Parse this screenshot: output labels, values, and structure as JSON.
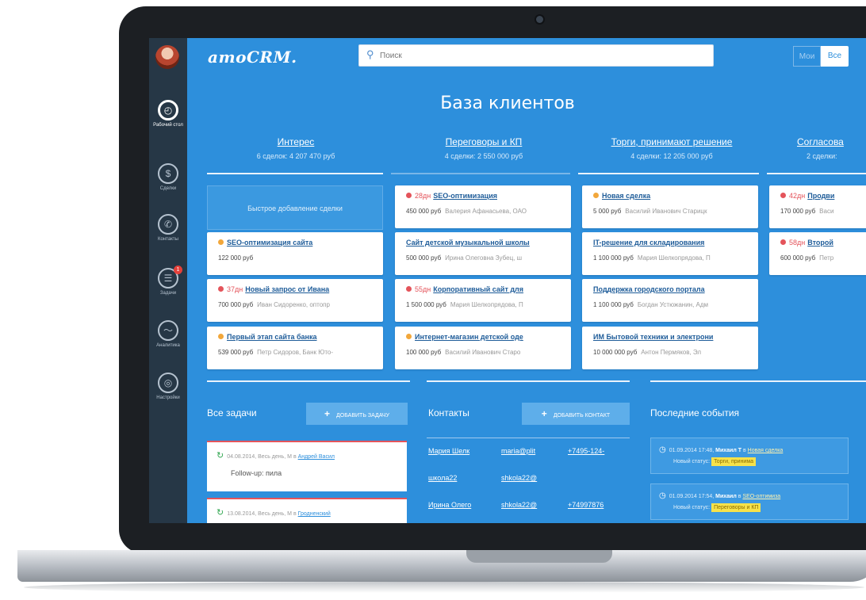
{
  "app": {
    "logo": "amoCRM.",
    "search_placeholder": "Поиск",
    "filter_my": "Мои",
    "filter_all": "Все",
    "page_title": "База клиентов"
  },
  "sidebar": {
    "items": [
      {
        "label": "Рабочий стол",
        "icon": "dashboard-icon"
      },
      {
        "label": "Сделки",
        "icon": "deals-icon"
      },
      {
        "label": "Контакты",
        "icon": "phone-icon"
      },
      {
        "label": "Задачи",
        "icon": "tasks-icon",
        "badge": "1"
      },
      {
        "label": "Аналитика",
        "icon": "analytics-icon"
      },
      {
        "label": "Настройки",
        "icon": "settings-icon"
      }
    ]
  },
  "stages": [
    {
      "name": "Интерес",
      "summary": "6 сделок: 4 207 470 руб"
    },
    {
      "name": "Переговоры и КП",
      "summary": "4 сделки: 2 550 000 руб"
    },
    {
      "name": "Торги, принимают решение",
      "summary": "4 сделки: 12 205 000 руб"
    },
    {
      "name": "Согласова",
      "summary": "2 сделки:"
    }
  ],
  "quick_add_label": "Быстрое добавление сделки",
  "columns": [
    [
      {
        "dot": "orange",
        "ago": "",
        "title": "SEO-оптимизация сайта",
        "price": "122 000 руб",
        "person": ""
      },
      {
        "dot": "red",
        "ago": "37дн",
        "title": "Новый запрос от Ивана",
        "price": "700 000 руб",
        "person": "Иван Сидоренко, оптопр"
      },
      {
        "dot": "orange",
        "ago": "",
        "title": "Первый этап сайта банка",
        "price": "539 000 руб",
        "person": "Петр Сидоров, Банк Юто-"
      }
    ],
    [
      {
        "dot": "red",
        "ago": "28дн",
        "title": "SEO-оптимизация",
        "price": "450 000 руб",
        "person": "Валерия Афанасьева, ОАО"
      },
      {
        "dot": "",
        "ago": "",
        "title": "Сайт детской музыкальной школы",
        "price": "500 000 руб",
        "person": "Ирина Олеговна Зубец, ш"
      },
      {
        "dot": "red",
        "ago": "55дн",
        "title": "Корпоративный сайт для",
        "price": "1 500 000 руб",
        "person": "Мария Шелкопрядова, П"
      },
      {
        "dot": "orange",
        "ago": "",
        "title": "Интернет-магазин детской оде",
        "price": "100 000 руб",
        "person": "Василий Иванович Старо"
      }
    ],
    [
      {
        "dot": "orange",
        "ago": "",
        "title": "Новая сделка",
        "price": "5 000 руб",
        "person": "Василий Иванович Старицк"
      },
      {
        "dot": "",
        "ago": "",
        "title": "IT-решение для складирования",
        "price": "1 100 000 руб",
        "person": "Мария Шелкопрядова, П"
      },
      {
        "dot": "",
        "ago": "",
        "title": "Поддержка городского портала",
        "price": "1 100 000 руб",
        "person": "Богдан Устюжанин, Адм"
      },
      {
        "dot": "",
        "ago": "",
        "title": "ИМ Бытовой техники и электрони",
        "price": "10 000 000 руб",
        "person": "Антон Пермяков, Эл"
      }
    ],
    [
      {
        "dot": "red",
        "ago": "42дн",
        "title": "Продви",
        "price": "170 000 руб",
        "person": "Васи"
      },
      {
        "dot": "red",
        "ago": "58дн",
        "title": "Второй",
        "price": "600 000 руб",
        "person": "Петр"
      }
    ]
  ],
  "tasks": {
    "title": "Все задачи",
    "add_label": "ДОБАВИТЬ ЗАДАЧУ",
    "items": [
      {
        "meta": "04.08.2014, Весь день, М",
        "link": "Андрей Васил",
        "text": "Follow-up: пила"
      },
      {
        "meta": "13.08.2014, Весь день, М",
        "link": "Гродненский",
        "text": ""
      }
    ]
  },
  "contacts": {
    "title": "Контакты",
    "add_label": "ДОБАВИТЬ КОНТАКТ",
    "rows": [
      {
        "name": "Мария Шелк",
        "email": "maria@plit",
        "phone": "+7495-124-"
      },
      {
        "name": "школа22",
        "email": "shkola22@",
        "phone": ""
      },
      {
        "name": "Ирина Олего",
        "email": "shkola22@",
        "phone": "+74997876"
      }
    ]
  },
  "events": {
    "title": "Последние события",
    "items": [
      {
        "meta": "01.09.2014 17:48,",
        "user": "Михаил Т",
        "verb": "в",
        "link": "Новая сделка",
        "status_label": "Новый статус:",
        "status": "Торги, принима"
      },
      {
        "meta": "01.09.2014 17:54,",
        "user": "Михаил",
        "verb": "в",
        "link": "SEO-оптимиза",
        "status_label": "Новый статус:",
        "status": "Переговоры и КП"
      }
    ]
  }
}
